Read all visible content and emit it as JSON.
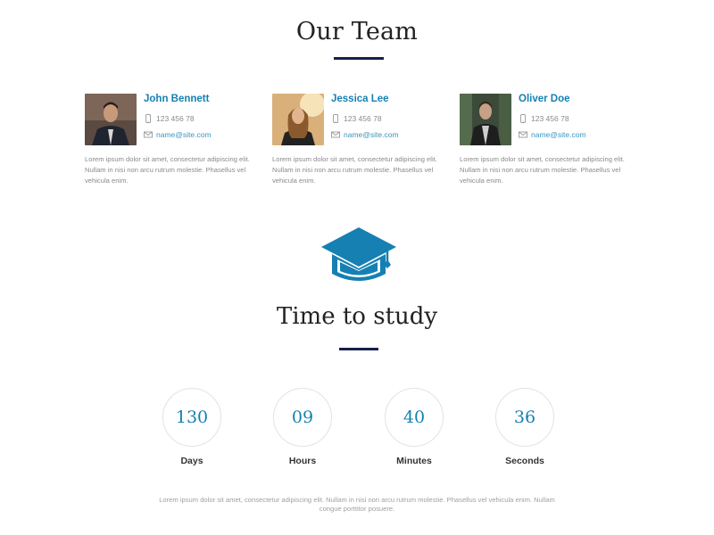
{
  "team": {
    "title": "Our Team",
    "members": [
      {
        "name": "John Bennett",
        "phone": "123 456 78",
        "email": "name@site.com",
        "bio": "Lorem ipsum dolor sit amet, consectetur adipiscing elit. Nullam in nisi non arcu rutrum molestie. Phasellus vel vehicula enim.",
        "photo": "portrait-man-suit"
      },
      {
        "name": "Jessica Lee",
        "phone": "123 456 78",
        "email": "name@site.com",
        "bio": "Lorem ipsum dolor sit amet, consectetur adipiscing elit. Nullam in nisi non arcu rutrum molestie. Phasellus vel vehicula enim.",
        "photo": "portrait-woman-sunlight"
      },
      {
        "name": "Oliver Doe",
        "phone": "123 456 78",
        "email": "name@site.com",
        "bio": "Lorem ipsum dolor sit amet, consectetur adipiscing elit. Nullam in nisi non arcu rutrum molestie. Phasellus vel vehicula enim.",
        "photo": "portrait-man-forest"
      }
    ]
  },
  "study": {
    "icon": "graduation-cap-icon",
    "title": "Time to study",
    "counters": [
      {
        "value": "130",
        "label": "Days"
      },
      {
        "value": "09",
        "label": "Hours"
      },
      {
        "value": "40",
        "label": "Minutes"
      },
      {
        "value": "36",
        "label": "Seconds"
      }
    ],
    "footer_text": "Lorem ipsum dolor sit amet, consectetur adipiscing elit. Nullam in nisi non arcu rutrum molestie. Phasellus vel vehicula enim. Nullam congue porttitor posuere."
  },
  "colors": {
    "accent": "#1680b3",
    "title_rule": "#16204a",
    "body_text": "#8a8a8a"
  }
}
